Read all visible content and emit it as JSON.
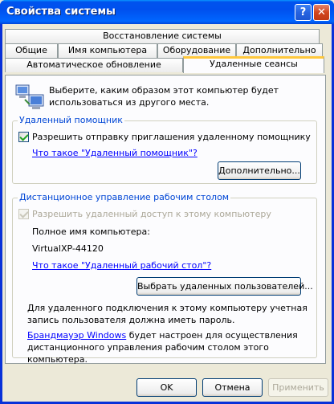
{
  "window": {
    "title": "Свойства системы"
  },
  "titlebar": {
    "help_glyph": "?",
    "close_glyph": "✕"
  },
  "tabs": {
    "row1": [
      "Восстановление системы"
    ],
    "row2": [
      "Общие",
      "Имя компьютера",
      "Оборудование",
      "Дополнительно"
    ],
    "row3": [
      "Автоматическое обновление",
      "Удаленные сеансы"
    ],
    "active": "Удаленные сеансы"
  },
  "intro": {
    "text": "Выберите, каким образом этот компьютер будет использоваться из другого места.",
    "icon": "remote-computers-icon"
  },
  "remote_assistance": {
    "legend": "Удаленный помощник",
    "checkbox_label": "Разрешить отправку приглашения удаленному помощнику",
    "checked": true,
    "link": "Что такое \"Удаленный помощник\"?",
    "advanced_button": "Дополнительно..."
  },
  "remote_desktop": {
    "legend": "Дистанционное управление рабочим столом",
    "checkbox_label": "Разрешить удаленный доступ к этому компьютеру",
    "checked": true,
    "disabled": true,
    "fullname_label": "Полное имя компьютера:",
    "computer_name": "VirtualXP-44120",
    "link": "Что такое \"Удаленный рабочий стол\"?",
    "select_users_button": "Выбрать удаленных пользователей...",
    "password_note": "Для удаленного подключения к этому компьютеру учетная запись пользователя должна иметь пароль.",
    "firewall_link": "Брандмауэр Windows",
    "firewall_note": " будет настроен для осуществления дистанционного управления рабочим столом этого компьютера."
  },
  "footer": {
    "ok": "OK",
    "cancel": "Отмена",
    "apply": "Применить"
  },
  "colors": {
    "title_bar": "#0058ee",
    "group_legend": "#0046d5",
    "tab_active_accent": "#ffc83c"
  }
}
